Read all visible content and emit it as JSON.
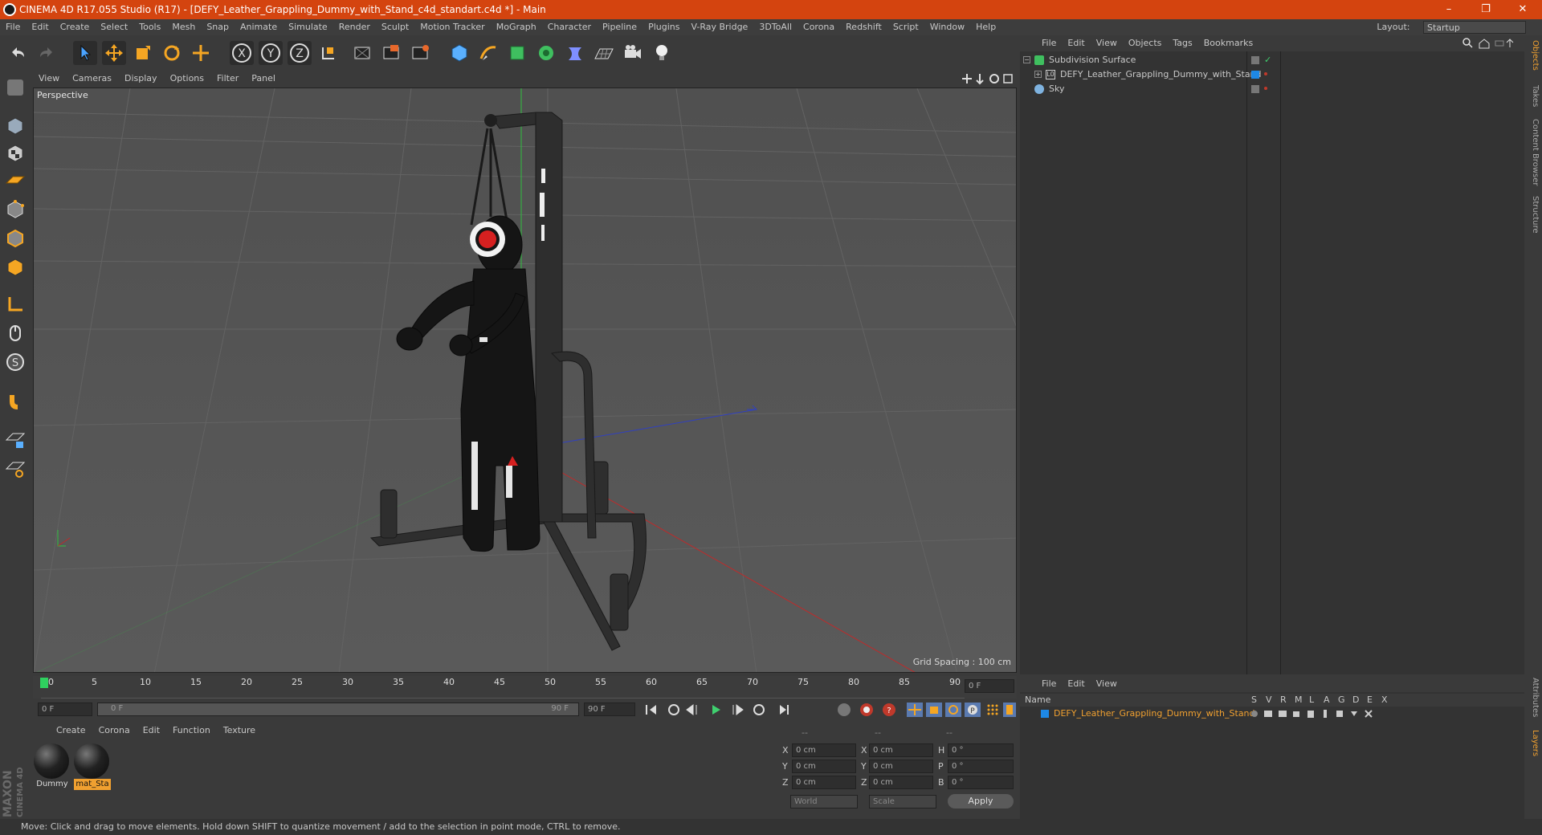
{
  "window": {
    "title": "CINEMA 4D R17.055 Studio (R17) - [DEFY_Leather_Grappling_Dummy_with_Stand_c4d_standart.c4d *] - Main",
    "minimize": "–",
    "maximize": "❐",
    "close": "✕"
  },
  "menubar": {
    "items": [
      "File",
      "Edit",
      "Create",
      "Select",
      "Tools",
      "Mesh",
      "Snap",
      "Animate",
      "Simulate",
      "Render",
      "Sculpt",
      "Motion Tracker",
      "MoGraph",
      "Character",
      "Pipeline",
      "Plugins",
      "V-Ray Bridge",
      "3DToAll",
      "Corona",
      "Redshift",
      "Script",
      "Window",
      "Help"
    ],
    "layout_label": "Layout:",
    "layout_value": "Startup"
  },
  "viewport": {
    "menu": [
      "View",
      "Cameras",
      "Display",
      "Options",
      "Filter",
      "Panel"
    ],
    "label": "Perspective",
    "grid_spacing": "Grid Spacing : 100 cm"
  },
  "timeline": {
    "ticks": [
      "0",
      "5",
      "10",
      "15",
      "20",
      "25",
      "30",
      "35",
      "40",
      "45",
      "50",
      "55",
      "60",
      "65",
      "70",
      "75",
      "80",
      "85",
      "90"
    ],
    "current_frame": "0 F",
    "start_field": "0 F",
    "range_start": "0 F",
    "range_end": "90 F",
    "end_field": "90 F"
  },
  "materials": {
    "menu": [
      "Create",
      "Corona",
      "Edit",
      "Function",
      "Texture"
    ],
    "items": [
      {
        "name": "Dummy",
        "selected": false
      },
      {
        "name": "mat_Sta",
        "selected": true
      }
    ]
  },
  "coordinates": {
    "headers": [
      "--",
      "--",
      "--"
    ],
    "rows": [
      {
        "a": "X",
        "av": "0 cm",
        "b": "X",
        "bv": "0 cm",
        "c": "H",
        "cv": "0 °"
      },
      {
        "a": "Y",
        "av": "0 cm",
        "b": "Y",
        "bv": "0 cm",
        "c": "P",
        "cv": "0 °"
      },
      {
        "a": "Z",
        "av": "0 cm",
        "b": "Z",
        "bv": "0 cm",
        "c": "B",
        "cv": "0 °"
      }
    ],
    "world": "World",
    "scale": "Scale",
    "apply": "Apply"
  },
  "objects": {
    "menu": [
      "File",
      "Edit",
      "View",
      "Objects",
      "Tags",
      "Bookmarks"
    ],
    "items": [
      {
        "name": "Subdivision Surface",
        "icon": "subdivision-icon",
        "color": "#6fcf6f"
      },
      {
        "name": "DEFY_Leather_Grappling_Dummy_with_Stand",
        "icon": "null-icon",
        "color": "#8fbfff"
      },
      {
        "name": "Sky",
        "icon": "sky-icon",
        "color": "#7fb3e0"
      }
    ]
  },
  "layers": {
    "menu": [
      "File",
      "Edit",
      "View"
    ],
    "name_header": "Name",
    "col_headers": [
      "S",
      "V",
      "R",
      "M",
      "L",
      "A",
      "G",
      "D",
      "E",
      "X"
    ],
    "items": [
      {
        "name": "DEFY_Leather_Grappling_Dummy_with_Stand",
        "color": "#1e88e5"
      }
    ]
  },
  "side_tabs": [
    "Objects",
    "Takes",
    "Content Browser",
    "Structure",
    "Attributes",
    "Layers"
  ],
  "branding": {
    "line1": "MAXON",
    "line2": "CINEMA 4D"
  },
  "status": "Move: Click and drag to move elements. Hold down SHIFT to quantize movement / add to the selection in point mode, CTRL to remove.",
  "colors": {
    "titlebar": "#d4440f",
    "accent": "#f0a030",
    "selected_layer_text": "#f0a030"
  }
}
